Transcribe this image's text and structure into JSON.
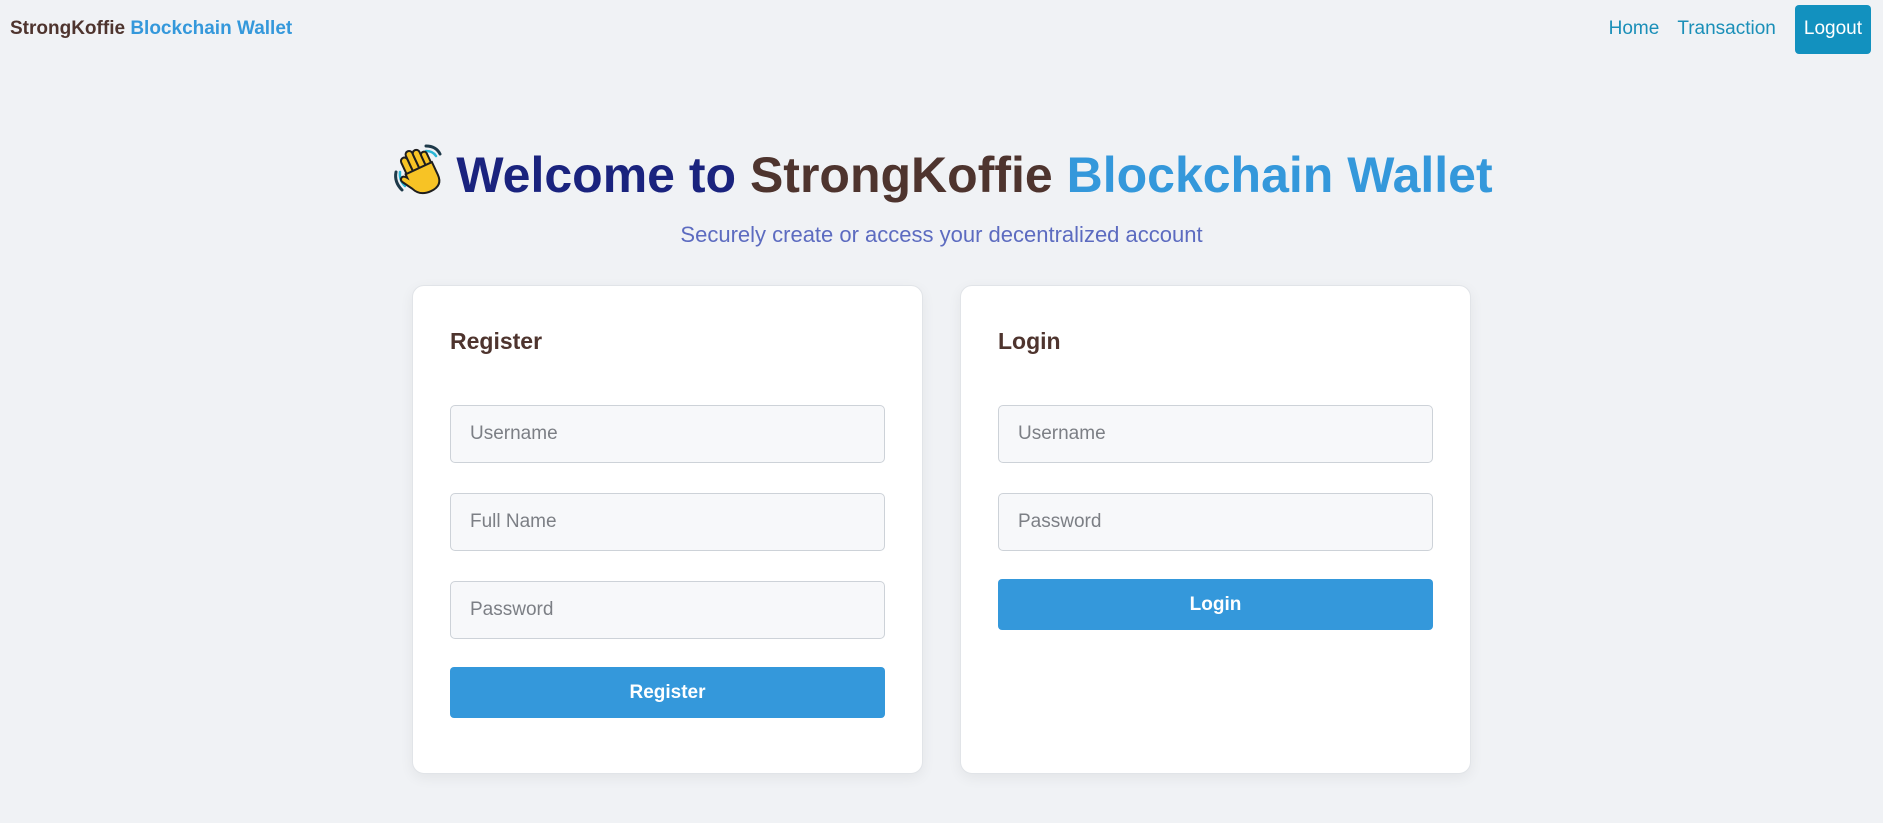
{
  "navbar": {
    "brand_part1": "StrongKoffie",
    "brand_part2": "Blockchain Wallet",
    "links": [
      {
        "label": "Home"
      },
      {
        "label": "Transaction"
      }
    ],
    "logout_label": "Logout"
  },
  "hero": {
    "icon": "waving-hand-icon",
    "title_part1": "Welcome to",
    "title_part2": "StrongKoffie",
    "title_part3": "Blockchain Wallet",
    "subtitle": "Securely create or access your decentralized account"
  },
  "register": {
    "title": "Register",
    "username_placeholder": "Username",
    "fullname_placeholder": "Full Name",
    "password_placeholder": "Password",
    "submit_label": "Register"
  },
  "login": {
    "title": "Login",
    "username_placeholder": "Username",
    "password_placeholder": "Password",
    "submit_label": "Login"
  },
  "colors": {
    "brand_brown": "#4e342e",
    "brand_blue": "#3498db",
    "title_navy": "#1a237e",
    "subtitle_indigo": "#5c6bc0",
    "nav_link": "#1a8fb8",
    "logout_bg": "#1291bf",
    "page_bg": "#f0f2f5"
  }
}
